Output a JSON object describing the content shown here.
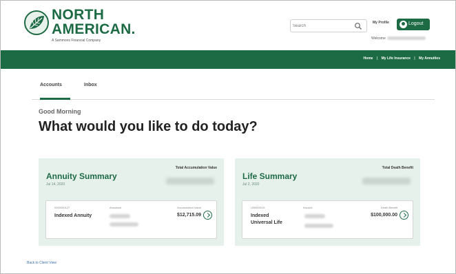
{
  "header": {
    "logo_line1": "NORTH",
    "logo_line2": "AMERICAN.",
    "logo_tagline": "A Sammons Financial Company",
    "search_placeholder": "Search",
    "my_profile": "My Profile",
    "logout": "Logout",
    "welcome": "Welcome"
  },
  "nav": {
    "links": [
      "Home",
      "My Life Insurance",
      "My Annuities"
    ],
    "separator": "|"
  },
  "tabs": [
    {
      "label": "Accounts",
      "active": true
    },
    {
      "label": "Inbox",
      "active": false
    }
  ],
  "greeting": "Good Morning",
  "headline": "What would you like to do today?",
  "annuity": {
    "title": "Annuity Summary",
    "date": "Jul 14, 2020",
    "total_label": "Total Accumulation Value",
    "policy_number": "0000000127",
    "product_line1": "Indexed Annuity",
    "product_line2": "",
    "annuitant_label": "Annuitant",
    "value_label": "Accumulation Value",
    "amount": "$12,715.09"
  },
  "life": {
    "title": "Life Summary",
    "date": "Jul 2, 2020",
    "total_label": "Total Death Benefit",
    "policy_number": "LB0000015",
    "product_line1": "Indexed",
    "product_line2": "Universal Life",
    "annuitant_label": "Insured",
    "value_label": "Death Benefit",
    "amount": "$100,000.00"
  },
  "back_link": "Back to Client View",
  "colors": {
    "brand_green": "#1d6b45",
    "card_bg": "#e7f1ec"
  }
}
